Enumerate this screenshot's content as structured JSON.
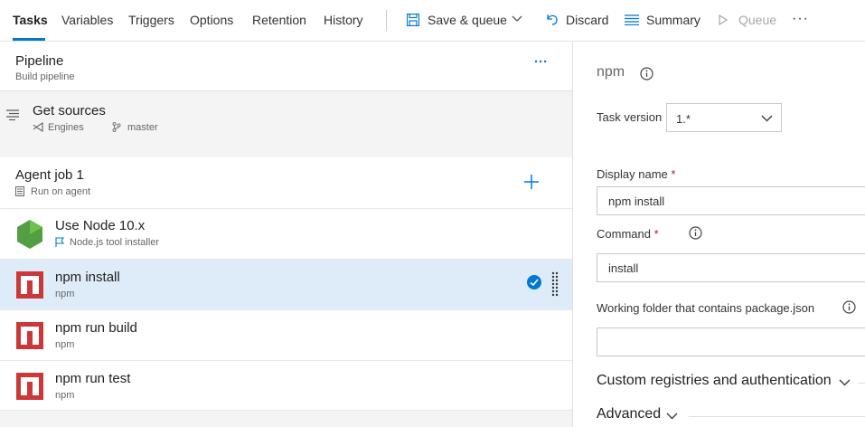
{
  "tabs": [
    "Tasks",
    "Variables",
    "Triggers",
    "Options",
    "Retention",
    "History"
  ],
  "toolbar": {
    "save_queue": "Save & queue",
    "discard": "Discard",
    "summary": "Summary",
    "queue": "Queue",
    "more": "···"
  },
  "pipeline": {
    "title": "Pipeline",
    "subtitle": "Build pipeline",
    "more": "···"
  },
  "sources": {
    "title": "Get sources",
    "repo": "Engines",
    "branch": "master"
  },
  "agent_job": {
    "title": "Agent job 1",
    "subtitle": "Run on agent"
  },
  "tasks": [
    {
      "title": "Use Node 10.x",
      "subtitle": "Node.js tool installer"
    },
    {
      "title": "npm install",
      "subtitle": "npm"
    },
    {
      "title": "npm run build",
      "subtitle": "npm"
    },
    {
      "title": "npm run test",
      "subtitle": "npm"
    }
  ],
  "detail": {
    "heading": "npm",
    "task_version_label": "Task version",
    "task_version_value": "1.*",
    "display_name_label": "Display name",
    "display_name_value": "npm install",
    "command_label": "Command",
    "command_value": "install",
    "working_folder_label": "Working folder that contains package.json",
    "working_folder_value": "",
    "required_mark": "*",
    "custom_registries": "Custom registries and authentication",
    "advanced": "Advanced"
  },
  "colors": {
    "accent": "#0078d4",
    "npm_red": "#cb3837",
    "node_green": "#539e43",
    "selected_row": "#deecf9"
  }
}
